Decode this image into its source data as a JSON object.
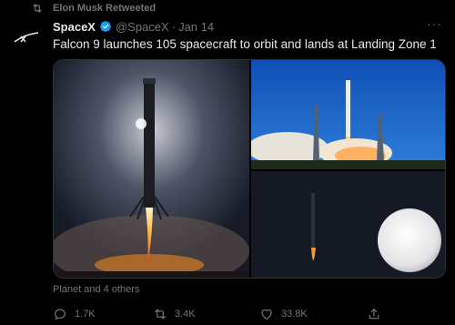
{
  "retweet": {
    "text": "Elon Musk Retweeted",
    "icon": "retweet-icon"
  },
  "tweet": {
    "author_name": "SpaceX",
    "handle": "@SpaceX",
    "separator": "·",
    "date": "Jan 14",
    "more_label": "···",
    "text": "Falcon 9 launches 105 spacecraft to orbit and lands at Landing Zone 1",
    "tagged": "Planet and 4 others"
  },
  "actions": {
    "replies": "1.7K",
    "retweets": "3.4K",
    "likes": "33.8K"
  },
  "colors": {
    "background": "#000000",
    "text": "#e7e9ea",
    "muted": "#71767b",
    "verified": "#1d9bf0"
  }
}
